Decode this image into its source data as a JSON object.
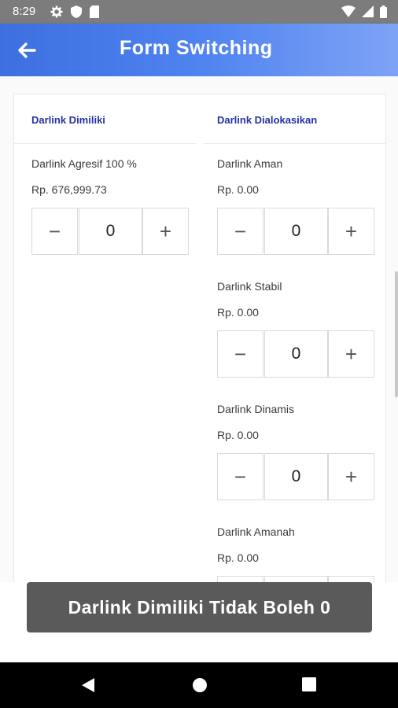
{
  "status_bar": {
    "time": "8:29",
    "icons_left": [
      "settings-icon",
      "shield-icon",
      "sd-card-icon"
    ],
    "icons_right": [
      "wifi-icon",
      "signal-icon",
      "battery-icon"
    ]
  },
  "app_bar": {
    "title": "Form Switching",
    "back_icon": "arrow-left-icon",
    "gradient": [
      "#3d6fe0",
      "#7ea3f6"
    ]
  },
  "left_column": {
    "header": "Darlink Dimiliki",
    "items": [
      {
        "label": "Darlink Agresif 100 %",
        "amount": "Rp. 676,999.73",
        "quantity": "0"
      }
    ]
  },
  "right_column": {
    "header": "Darlink Dialokasikan",
    "items": [
      {
        "label": "Darlink Aman",
        "amount": "Rp. 0.00",
        "quantity": "0"
      },
      {
        "label": "Darlink Stabil",
        "amount": "Rp. 0.00",
        "quantity": "0"
      },
      {
        "label": "Darlink Dinamis",
        "amount": "Rp. 0.00",
        "quantity": "0"
      },
      {
        "label": "Darlink Amanah",
        "amount": "Rp. 0.00",
        "quantity": "0"
      }
    ]
  },
  "stepper": {
    "minus": "−",
    "plus": "+"
  },
  "toast": {
    "message": "Darlink Dimiliki Tidak Boleh 0"
  },
  "colors": {
    "header_text": "#2431a8",
    "toast_bg": "#5a5a5a"
  },
  "nav_bar": {
    "buttons": [
      "back-triangle-icon",
      "home-circle-icon",
      "recents-square-icon"
    ]
  }
}
